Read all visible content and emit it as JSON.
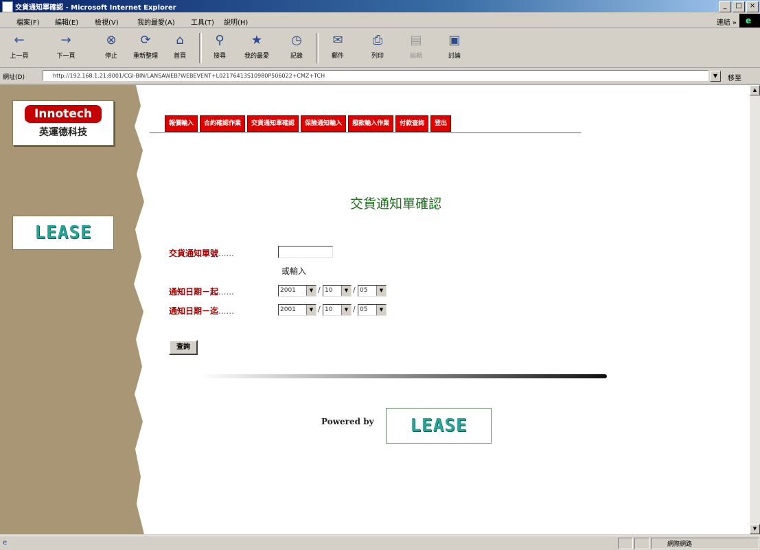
{
  "window": {
    "title": "交貨通知單確認 - Microsoft Internet Explorer",
    "min": "_",
    "max": "□",
    "close": "×"
  },
  "menu": [
    "檔案(F)",
    "編輯(E)",
    "檢視(V)",
    "我的最愛(A)",
    "工具(T)",
    "說明(H)"
  ],
  "menu_links": "連結 »",
  "toolbar": {
    "back": "上一頁",
    "forward": "下一頁",
    "stop": "停止",
    "refresh": "重新整理",
    "home": "首頁",
    "search": "搜尋",
    "favorites": "我的最愛",
    "history": "記錄",
    "mail": "郵件",
    "print": "列印",
    "edit": "編輯",
    "discuss": "討論"
  },
  "address": {
    "label": "網址(D)",
    "url": "http://192.168.1.21:8001/CGI-BIN/LANSAWEB?WEBEVENT+L02176413S10980P506022+CMZ+TCH",
    "go": "移至"
  },
  "logo": {
    "brand": "Innotech",
    "sub": "英運德科技"
  },
  "lease_logo": "LEASE",
  "nav_tabs": [
    "報價輸入",
    "合約確認作業",
    "交貨通知單確認",
    "保險通知輸入",
    "撥款輸入作業",
    "付款查詢",
    "登出"
  ],
  "page_title": "交貨通知單確認",
  "form": {
    "notice_no_label": "交貨通知單號",
    "or_label": "或輸入",
    "date_from_label": "通知日期－起",
    "date_to_label": "通知日期－迄",
    "dots": "......",
    "from": {
      "year": "2001",
      "month": "10",
      "day": "05"
    },
    "to": {
      "year": "2001",
      "month": "10",
      "day": "05"
    },
    "query_button": "查詢"
  },
  "footer": {
    "powered_by": "Powered by"
  },
  "status": {
    "zone": "網際網路"
  }
}
